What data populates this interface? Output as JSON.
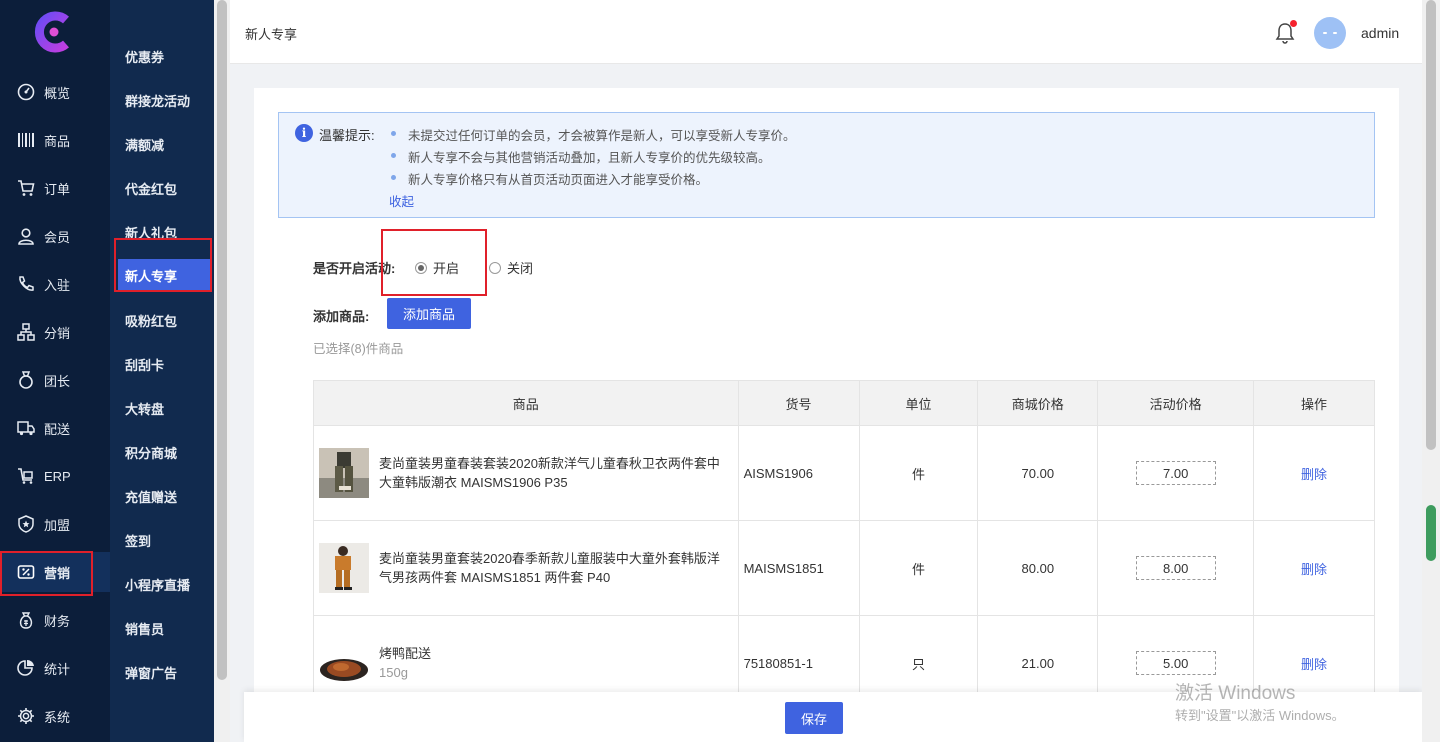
{
  "sidebar": {
    "items": [
      {
        "label": "概览",
        "icon": "dashboard-icon"
      },
      {
        "label": "商品",
        "icon": "barcode-icon"
      },
      {
        "label": "订单",
        "icon": "cart-icon"
      },
      {
        "label": "会员",
        "icon": "user-icon"
      },
      {
        "label": "入驻",
        "icon": "phone-icon"
      },
      {
        "label": "分销",
        "icon": "hierarchy-icon"
      },
      {
        "label": "团长",
        "icon": "ring-icon"
      },
      {
        "label": "配送",
        "icon": "truck-icon"
      },
      {
        "label": "ERP",
        "icon": "erp-icon"
      },
      {
        "label": "加盟",
        "icon": "shield-star-icon"
      },
      {
        "label": "营销",
        "icon": "coupon-icon"
      },
      {
        "label": "财务",
        "icon": "money-bag-icon"
      },
      {
        "label": "统计",
        "icon": "pie-chart-icon"
      },
      {
        "label": "系统",
        "icon": "gear-icon"
      }
    ],
    "active": "营销"
  },
  "subnav": {
    "items": [
      "优惠券",
      "群接龙活动",
      "满额减",
      "代金红包",
      "新人礼包",
      "新人专享",
      "吸粉红包",
      "刮刮卡",
      "大转盘",
      "积分商城",
      "充值赠送",
      "签到",
      "小程序直播",
      "销售员",
      "弹窗广告"
    ],
    "active": "新人专享"
  },
  "header": {
    "title": "新人专享",
    "username": "admin"
  },
  "notice": {
    "label": "温馨提示:",
    "items": [
      "未提交过任何订单的会员，才会被算作是新人，可以享受新人专享价。",
      "新人专享不会与其他营销活动叠加，且新人专享价的优先级较高。",
      "新人专享价格只有从首页活动页面进入才能享受价格。"
    ],
    "collapse": "收起"
  },
  "form": {
    "activity_label": "是否开启活动:",
    "on_label": "开启",
    "off_label": "关闭",
    "activity_enabled": true,
    "add_goods_label": "添加商品:",
    "add_goods_button": "添加商品",
    "selected_note": "已选择(8)件商品"
  },
  "table": {
    "headers": [
      "商品",
      "货号",
      "单位",
      "商城价格",
      "活动价格",
      "操作"
    ],
    "rows": [
      {
        "name": "麦尚童装男童春装套装2020新款洋气儿童春秋卫衣两件套中大童韩版潮衣 MAISMS1906 P35",
        "sub": "",
        "sku": "AISMS1906",
        "unit": "件",
        "price": "70.00",
        "activity_price": "7.00",
        "action": "删除"
      },
      {
        "name": "麦尚童装男童套装2020春季新款儿童服装中大童外套韩版洋气男孩两件套 MAISMS1851 两件套 P40",
        "sub": "",
        "sku": "MAISMS1851",
        "unit": "件",
        "price": "80.00",
        "activity_price": "8.00",
        "action": "删除"
      },
      {
        "name": "烤鸭配送",
        "sub": "150g",
        "sku": "75180851-1",
        "unit": "只",
        "price": "21.00",
        "activity_price": "5.00",
        "action": "删除"
      }
    ]
  },
  "footer": {
    "save": "保存"
  },
  "watermark": {
    "line1": "激活 Windows",
    "line2": "转到\"设置\"以激活 Windows。"
  },
  "colors": {
    "sidebar_bg": "#0c1e3a",
    "subnav_bg": "#112a4e",
    "primary": "#3f63e0",
    "highlight_box": "#e0202a"
  }
}
